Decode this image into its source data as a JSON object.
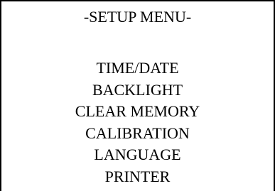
{
  "menu": {
    "title": "-SETUP MENU-",
    "items": [
      "TIME/DATE",
      "BACKLIGHT",
      "CLEAR MEMORY",
      "CALIBRATION",
      "LANGUAGE",
      "PRINTER"
    ]
  }
}
